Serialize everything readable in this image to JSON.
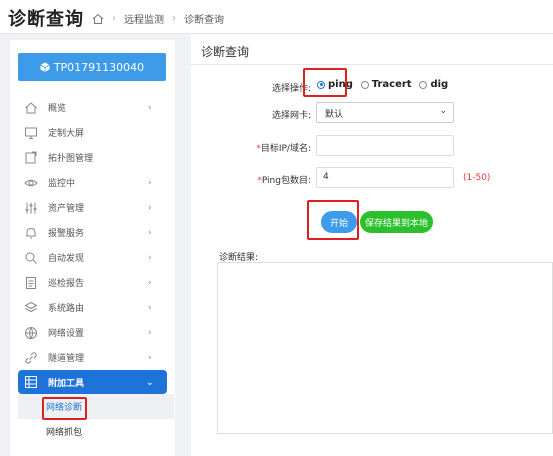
{
  "header": {
    "title": "诊断查询",
    "breadcrumb": [
      "远程监测",
      "诊断查询"
    ]
  },
  "sidebar": {
    "device_id": "TP01791130040",
    "items": [
      {
        "label": "概览",
        "icon": "home-icon",
        "has_arrow": true
      },
      {
        "label": "定制大屏",
        "icon": "monitor-icon",
        "has_arrow": false
      },
      {
        "label": "拓扑图管理",
        "icon": "topology-icon",
        "has_arrow": false
      },
      {
        "label": "监控中",
        "icon": "eye-icon",
        "has_arrow": true
      },
      {
        "label": "资产管理",
        "icon": "sliders-icon",
        "has_arrow": true
      },
      {
        "label": "报警服务",
        "icon": "bell-icon",
        "has_arrow": true
      },
      {
        "label": "自动发现",
        "icon": "search-icon",
        "has_arrow": true
      },
      {
        "label": "巡检报告",
        "icon": "report-icon",
        "has_arrow": true
      },
      {
        "label": "系统路由",
        "icon": "layers-icon",
        "has_arrow": true
      },
      {
        "label": "网络设置",
        "icon": "globe-icon",
        "has_arrow": true
      },
      {
        "label": "隧道管理",
        "icon": "link-icon",
        "has_arrow": true
      },
      {
        "label": "附加工具",
        "icon": "tools-icon",
        "has_arrow": true,
        "expanded": true
      }
    ],
    "sub_items": [
      {
        "label": "网络诊断",
        "selected": true
      },
      {
        "label": "网络抓包",
        "selected": false
      }
    ]
  },
  "main": {
    "title": "诊断查询",
    "operation_label": "选择操作:",
    "operations": [
      {
        "label": "ping",
        "checked": true
      },
      {
        "label": "Tracert",
        "checked": false
      },
      {
        "label": "dig",
        "checked": false
      }
    ],
    "nic_label": "选择网卡:",
    "nic_value": "默认",
    "target_label": "目标IP/域名:",
    "target_value": "",
    "ping_count_label": "Ping包数目:",
    "ping_count_value": "4",
    "ping_count_hint": "(1-50)",
    "start_button": "开始",
    "save_button": "保存结果到本地",
    "result_label": "诊断结果:"
  },
  "colors": {
    "primary": "#1e73d8",
    "device_button": "#3d9be9",
    "save_button": "#2dc02d",
    "required": "#e53935",
    "highlight_box": "#e02020"
  }
}
